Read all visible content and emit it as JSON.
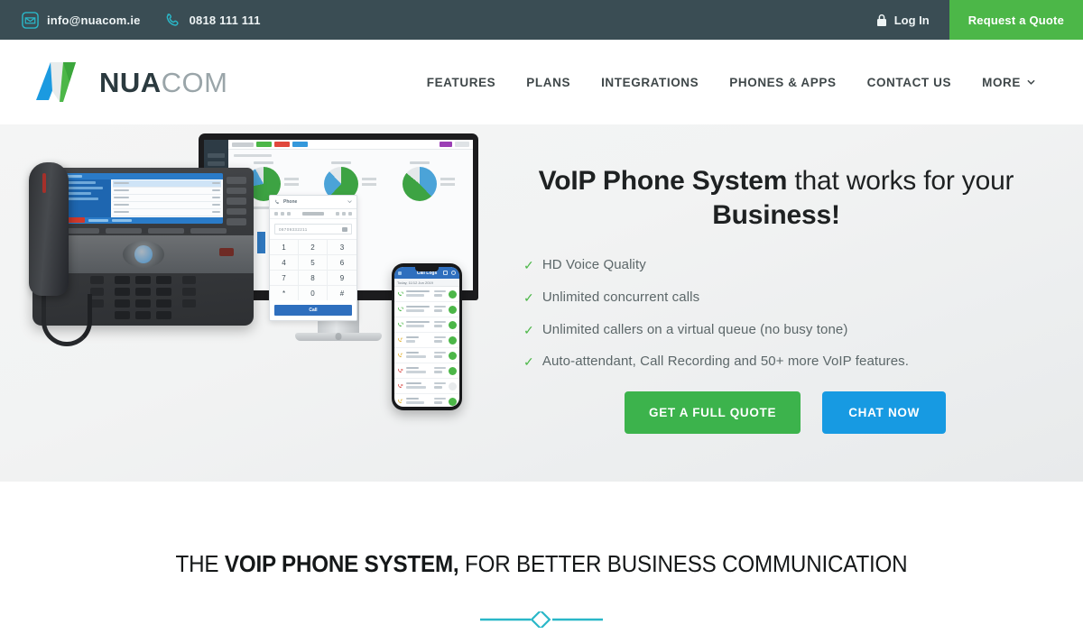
{
  "topbar": {
    "email": "info@nuacom.ie",
    "phone": "0818 111 111",
    "email_icon": "envelope-icon",
    "phone_icon": "phone-handset-icon",
    "login_label": "Log In",
    "login_icon": "lock-icon",
    "quote_label": "Request a Quote",
    "bg_color": "#3a4d54",
    "accent_color": "#2ab7c8",
    "quote_color": "#4cb748"
  },
  "brand": {
    "name_bold": "NUA",
    "name_light": "COM",
    "logo_icon": "nuacom-n-logo-icon",
    "logo_blue": "#1b9ae0",
    "logo_green": "#4cb748"
  },
  "nav": {
    "items": [
      {
        "label": "FEATURES"
      },
      {
        "label": "PLANS"
      },
      {
        "label": "INTEGRATIONS"
      },
      {
        "label": "PHONES & APPS"
      },
      {
        "label": "CONTACT US"
      },
      {
        "label": "MORE",
        "icon": "chevron-down-icon"
      }
    ]
  },
  "hero": {
    "title_pre": "VoIP Phone System",
    "title_mid": " that works for your ",
    "title_post": "Business!",
    "bullets": [
      "HD Voice Quality",
      "Unlimited concurrent calls",
      "Unlimited callers on a virtual queue (no busy tone)",
      "Auto-attendant, Call Recording and 50+ more VoIP features."
    ],
    "tick": "✓",
    "primary_cta": "GET A FULL QUOTE",
    "secondary_cta": "CHAT NOW",
    "primary_color": "#3cb34c",
    "secondary_color": "#179ae2",
    "image_alt": "voip-devices-photo"
  },
  "hero_devices": {
    "dialer": {
      "title": "Phone",
      "number": "08709332211",
      "keys": [
        "1",
        "2",
        "3",
        "4",
        "5",
        "6",
        "7",
        "8",
        "9",
        "*",
        "0",
        "#"
      ],
      "call_label": "Call"
    },
    "mobile": {
      "title": "Call Logs",
      "date": "Today, 11/12 Jun 2019"
    }
  },
  "section2": {
    "title_pre": "THE ",
    "title_bold": "VOIP PHONE SYSTEM,",
    "title_post": " FOR BETTER BUSINESS COMMUNICATION",
    "divider_icon": "diamond-divider-icon",
    "divider_color": "#2ab7c8"
  }
}
